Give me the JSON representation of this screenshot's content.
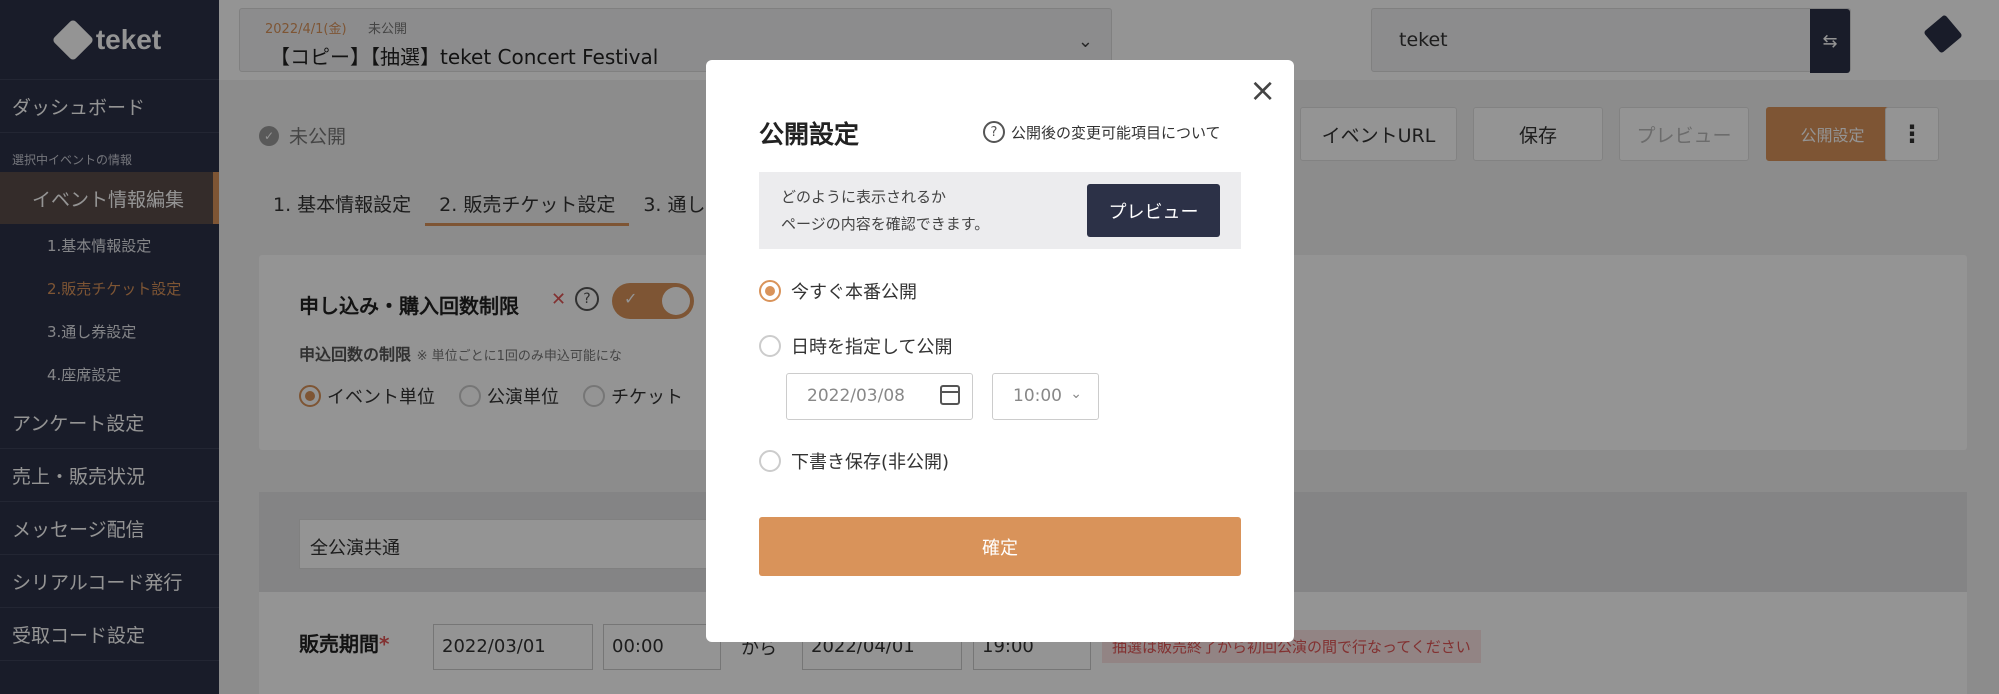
{
  "sidebar": {
    "logo": "teket",
    "items_top": [
      "ダッシュボード"
    ],
    "section_label": "選択中イベントの情報",
    "active_item": "イベント情報編集",
    "sub_items": [
      "1.基本情報設定",
      "2.販売チケット設定",
      "3.通し券設定",
      "4.座席設定"
    ],
    "items_bottom": [
      "アンケート設定",
      "売上・販売状況",
      "メッセージ配信",
      "シリアルコード発行",
      "受取コード設定"
    ]
  },
  "topbar": {
    "event_date": "2022/4/1(金)",
    "event_status": "未公開",
    "event_title": "【コピー】【抽選】teket Concert Festival",
    "organization": "teket"
  },
  "main": {
    "status": "未公開",
    "buttons": {
      "event_url": "イベントURL",
      "save": "保存",
      "preview": "プレビュー",
      "publish": "公開設定"
    },
    "tabs": [
      "1. 基本情報設定",
      "2. 販売チケット設定",
      "3. 通し"
    ],
    "limit_card": {
      "title": "申し込み・購入回数制限",
      "limit_label": "申込回数の制限",
      "limit_note": "※ 単位ごとに1回のみ申込可能にな",
      "options": [
        "イベント単位",
        "公演単位",
        "チケット"
      ]
    },
    "common": "全公演共通",
    "sales": {
      "label": "販売期間",
      "required": "*",
      "start_date": "2022/03/01",
      "start_time": "00:00",
      "from": "から",
      "end_date": "2022/04/01",
      "end_time": "19:00",
      "warning": "抽選は販売終了から初回公演の間で行なってください"
    }
  },
  "modal": {
    "title": "公開設定",
    "help": "公開後の変更可能項目について",
    "preview_desc_1": "どのように表示されるか",
    "preview_desc_2": "ページの内容を確認できます。",
    "preview_button": "プレビュー",
    "options": {
      "now": "今すぐ本番公開",
      "scheduled": "日時を指定して公開",
      "draft": "下書き保存(非公開)"
    },
    "schedule_date_placeholder": "2022/03/08",
    "schedule_time_placeholder": "10:00",
    "confirm_button": "確定"
  }
}
